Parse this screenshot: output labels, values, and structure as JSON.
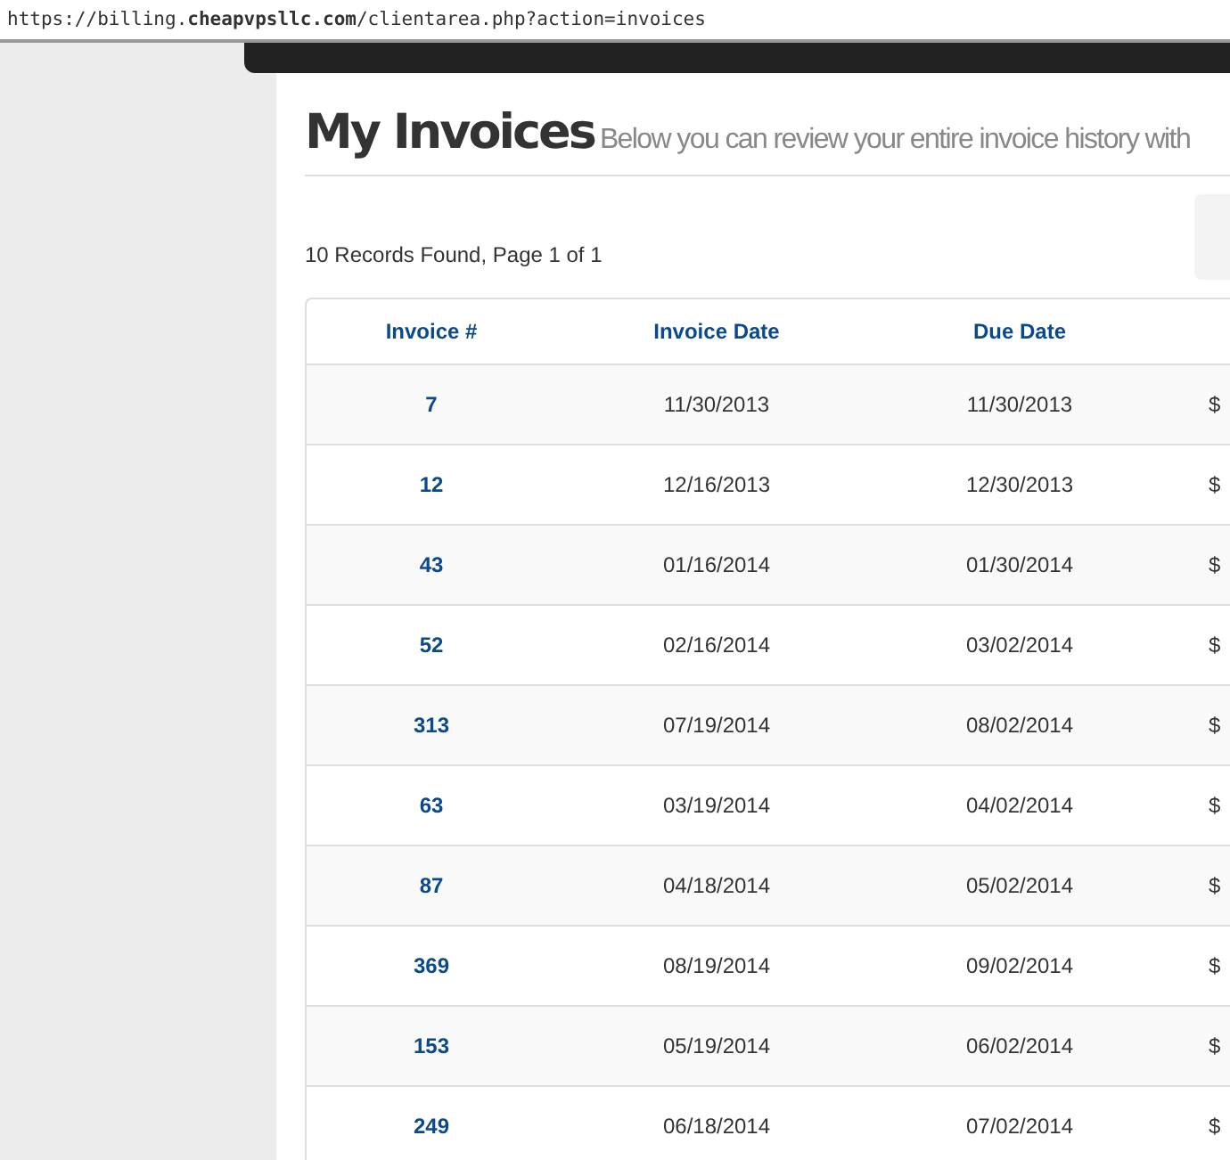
{
  "address_bar": {
    "url": "https://billing.**cheapvpsllc.com**/clientarea.php?action=invoices"
  },
  "page": {
    "title": "My Invoices",
    "subtitle": "Below you can review your entire invoice history with"
  },
  "records_summary": "10 Records Found, Page 1 of 1",
  "table": {
    "columns": [
      "Invoice #",
      "Invoice Date",
      "Due Date"
    ],
    "rows": [
      {
        "invoice": "7",
        "invoice_date": "11/30/2013",
        "due_date": "11/30/2013",
        "column_4": "$"
      },
      {
        "invoice": "12",
        "invoice_date": "12/16/2013",
        "due_date": "12/30/2013",
        "column_4": "$"
      },
      {
        "invoice": "43",
        "invoice_date": "01/16/2014",
        "due_date": "01/30/2014",
        "column_4": "$"
      },
      {
        "invoice": "52",
        "invoice_date": "02/16/2014",
        "due_date": "03/02/2014",
        "column_4": "$"
      },
      {
        "invoice": "313",
        "invoice_date": "07/19/2014",
        "due_date": "08/02/2014",
        "column_4": "$"
      },
      {
        "invoice": "63",
        "invoice_date": "03/19/2014",
        "due_date": "04/02/2014",
        "column_4": "$"
      },
      {
        "invoice": "87",
        "invoice_date": "04/18/2014",
        "due_date": "05/02/2014",
        "column_4": "$"
      },
      {
        "invoice": "369",
        "invoice_date": "08/19/2014",
        "due_date": "09/02/2014",
        "column_4": "$"
      },
      {
        "invoice": "153",
        "invoice_date": "05/19/2014",
        "due_date": "06/02/2014",
        "column_4": "$"
      },
      {
        "invoice": "249",
        "invoice_date": "06/18/2014",
        "due_date": "07/02/2014",
        "column_4": "$"
      }
    ]
  }
}
